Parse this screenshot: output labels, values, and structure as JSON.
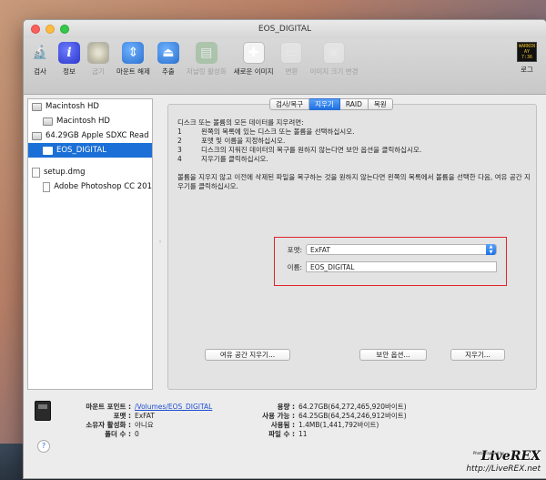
{
  "window": {
    "title": "EOS_DIGITAL"
  },
  "toolbar": {
    "items": [
      {
        "label": "검사",
        "icon": "microscope-icon",
        "enabled": true
      },
      {
        "label": "정보",
        "icon": "info-icon",
        "enabled": true
      },
      {
        "label": "굽기",
        "icon": "burn-disc-icon",
        "enabled": false
      },
      {
        "label": "마운트 해제",
        "icon": "unmount-icon",
        "enabled": true
      },
      {
        "label": "추출",
        "icon": "eject-icon",
        "enabled": true
      },
      {
        "label": "저널링 활성화",
        "icon": "journal-icon",
        "enabled": false
      },
      {
        "label": "새로운 이미지",
        "icon": "new-image-icon",
        "enabled": true
      },
      {
        "label": "변환",
        "icon": "convert-icon",
        "enabled": false
      },
      {
        "label": "이미지 크기 변경",
        "icon": "resize-image-icon",
        "enabled": false
      }
    ],
    "log": {
      "label": "로그",
      "icon_text_1": "WARNIN",
      "icon_text_2": "AY 7:36"
    }
  },
  "sidebar": {
    "items": [
      {
        "label": "Macintosh HD",
        "level": 0,
        "kind": "disk"
      },
      {
        "label": "Macintosh HD",
        "level": 1,
        "kind": "disk"
      },
      {
        "label": "64.29GB Apple SDXC Read",
        "level": 0,
        "kind": "disk"
      },
      {
        "label": "EOS_DIGITAL",
        "level": 1,
        "kind": "disk",
        "selected": true
      },
      {
        "label": "setup.dmg",
        "level": 0,
        "kind": "file"
      },
      {
        "label": "Adobe Photoshop CC 201",
        "level": 1,
        "kind": "file"
      }
    ]
  },
  "tabs": [
    {
      "label": "검사/복구",
      "active": false
    },
    {
      "label": "지우기",
      "active": true
    },
    {
      "label": "RAID",
      "active": false
    },
    {
      "label": "복원",
      "active": false
    }
  ],
  "erase": {
    "intro": "디스크 또는 볼륨의 모든 데이터를 지우려면:",
    "steps": [
      {
        "num": "1",
        "text": "왼쪽의 목록에 있는 디스크 또는 볼륨을 선택하십시오."
      },
      {
        "num": "2",
        "text": "포맷 및 이름을 지정하십시오."
      },
      {
        "num": "3",
        "text": "디스크의 지워진 데이터의 복구를 원하지 않는다면 보안 옵션을 클릭하십시오."
      },
      {
        "num": "4",
        "text": "지우기를 클릭하십시오."
      }
    ],
    "note": "볼륨을 지우지 않고 이전에 삭제된 파일을 복구하는 것을 원하지 않는다면 왼쪽의 목록에서 볼륨을 선택한 다음, 여유 공간 지우기를 클릭하십시오.",
    "format_label": "포맷:",
    "format_value": "ExFAT",
    "name_label": "이름:",
    "name_value": "EOS_DIGITAL",
    "free_space_button": "여유 공간 지우기...",
    "security_button": "보안 옵션...",
    "erase_button": "지우기..."
  },
  "info": {
    "mount_point_label": "마운트 포인트 :",
    "mount_point_value": "/Volumes/EOS_DIGITAL",
    "format_label": "포맷 :",
    "format_value": "ExFAT",
    "owners_label": "소유자 활성화 :",
    "owners_value": "아니요",
    "folders_label": "폴더 수 :",
    "folders_value": "0",
    "capacity_label": "용량 :",
    "capacity_value": "64.27GB(64,272,465,920바이트)",
    "available_label": "사용 가능 :",
    "available_value": "64.25GB(64,254,246,912바이트)",
    "used_label": "사용됨 :",
    "used_value": "1.4MB(1,441,792바이트)",
    "files_label": "파일 수 :",
    "files_value": "11",
    "help_symbol": "?"
  },
  "watermark": {
    "small_text": "Photographed by",
    "sign": "LiveREX",
    "url": "http://LiveREX.net"
  },
  "colors": {
    "selection": "#1b6fd6",
    "highlight_box": "#e0242a",
    "link": "#1d4fd0"
  }
}
